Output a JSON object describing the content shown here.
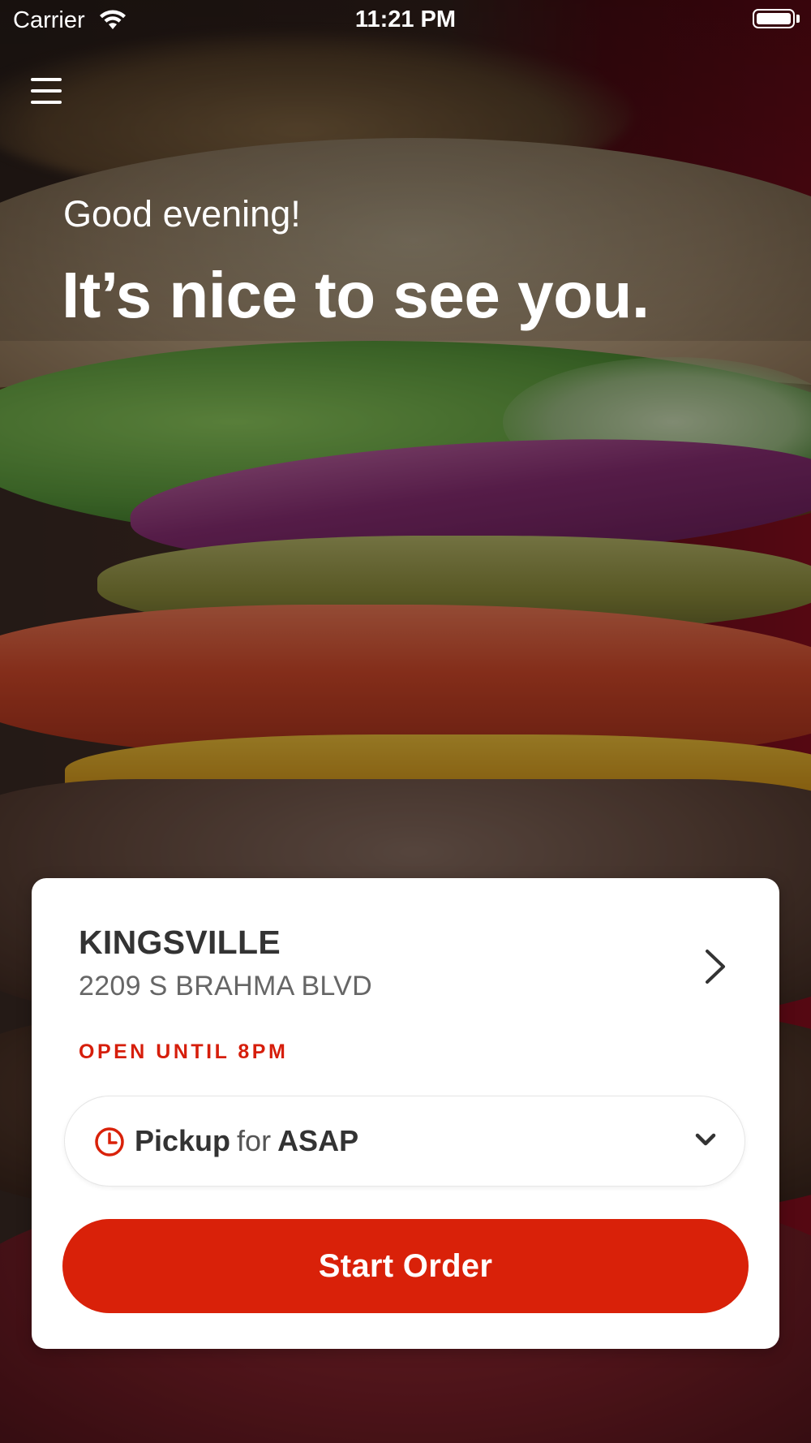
{
  "status_bar": {
    "carrier": "Carrier",
    "time": "11:21 PM"
  },
  "menu": {
    "icon": "hamburger-menu-icon"
  },
  "hero": {
    "greeting": "Good evening!",
    "headline": "It’s nice to see you."
  },
  "location_card": {
    "store_name": "KINGSVILLE",
    "store_address": "2209 S BRAHMA BLVD",
    "hours_status": "OPEN UNTIL 8PM",
    "order_mode": {
      "method": "Pickup",
      "connector": "for",
      "time": "ASAP"
    },
    "start_order_label": "Start Order"
  },
  "colors": {
    "brand_red": "#d92109",
    "open_text_red": "#d61e0b",
    "text_dark": "#333333",
    "text_muted": "#666666"
  }
}
